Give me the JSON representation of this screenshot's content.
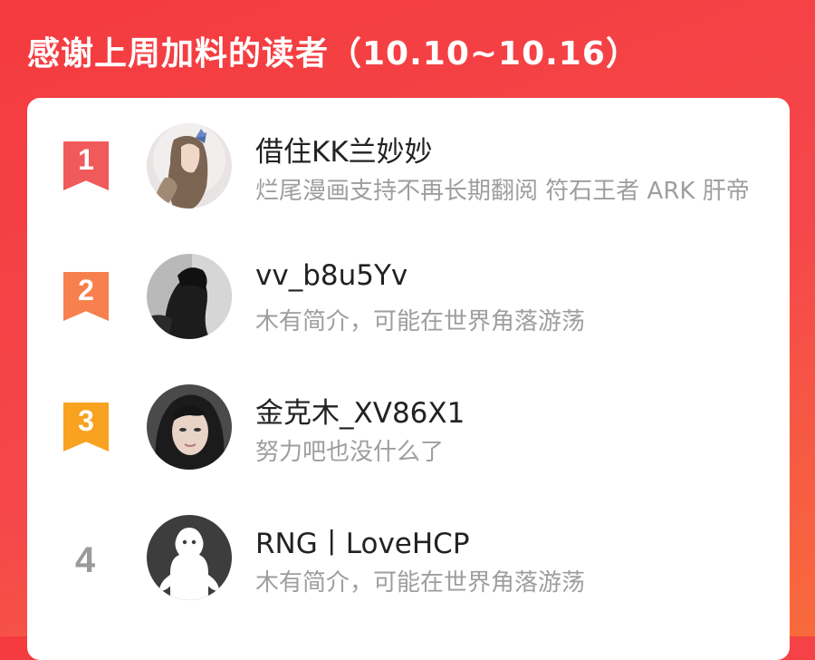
{
  "header": {
    "title": "感谢上周加料的读者（10.10~10.16）"
  },
  "colors": {
    "background": "#f43b3f",
    "rank1": "#f15a5a",
    "rank2": "#f7804e",
    "rank3": "#f8a21f",
    "rank_plain": "#9a9a9a"
  },
  "readers": [
    {
      "rank": "1",
      "name": "借住KK兰妙妙",
      "bio": "烂尾漫画支持不再长期翻阅 符石王者 ARK 肝帝",
      "avatar": "avatar-girl-with-bow"
    },
    {
      "rank": "2",
      "name": "vv_b8u5Yv",
      "bio": "木有简介，可能在世界角落游荡",
      "avatar": "avatar-dark-figure"
    },
    {
      "rank": "3",
      "name": "金克木_XV86X1",
      "bio": "努力吧也没什么了",
      "avatar": "avatar-woman-portrait"
    },
    {
      "rank": "4",
      "name": "RNG丨LoveHCP",
      "bio": "木有简介，可能在世界角落游荡",
      "avatar": "default-avatar-icon"
    }
  ]
}
